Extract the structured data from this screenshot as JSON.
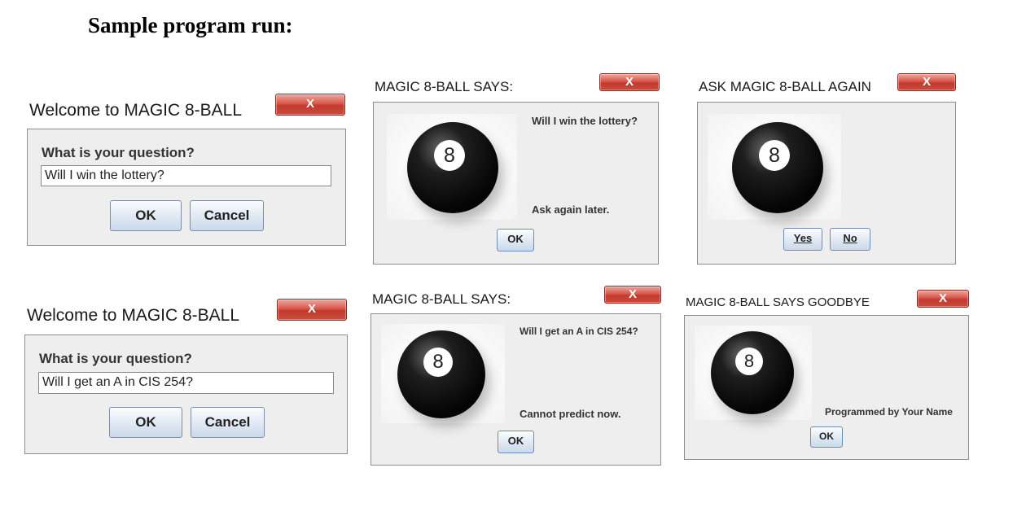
{
  "heading": "Sample program run:",
  "close_glyph": "X",
  "ball_digit": "8",
  "dialogs": {
    "welcome1": {
      "title": "Welcome to MAGIC 8-BALL",
      "prompt": "What is your question?",
      "input_value": "Will I win the lottery?",
      "ok_label": "OK",
      "cancel_label": "Cancel"
    },
    "says1": {
      "title": "MAGIC 8-BALL SAYS:",
      "question": "Will I win the lottery?",
      "answer": "Ask again later.",
      "ok_label": "OK"
    },
    "again": {
      "title": "ASK MAGIC 8-BALL AGAIN",
      "yes_label": "Yes",
      "no_label": "No"
    },
    "welcome2": {
      "title": "Welcome to MAGIC 8-BALL",
      "prompt": "What is your question?",
      "input_value": "Will I get an A in CIS 254?",
      "ok_label": "OK",
      "cancel_label": "Cancel"
    },
    "says2": {
      "title": "MAGIC 8-BALL SAYS:",
      "question": "Will I get an A in CIS 254?",
      "answer": "Cannot predict now.",
      "ok_label": "OK"
    },
    "goodbye": {
      "title": "MAGIC 8-BALL SAYS GOODBYE",
      "message": "Programmed by Your Name",
      "ok_label": "OK"
    }
  }
}
